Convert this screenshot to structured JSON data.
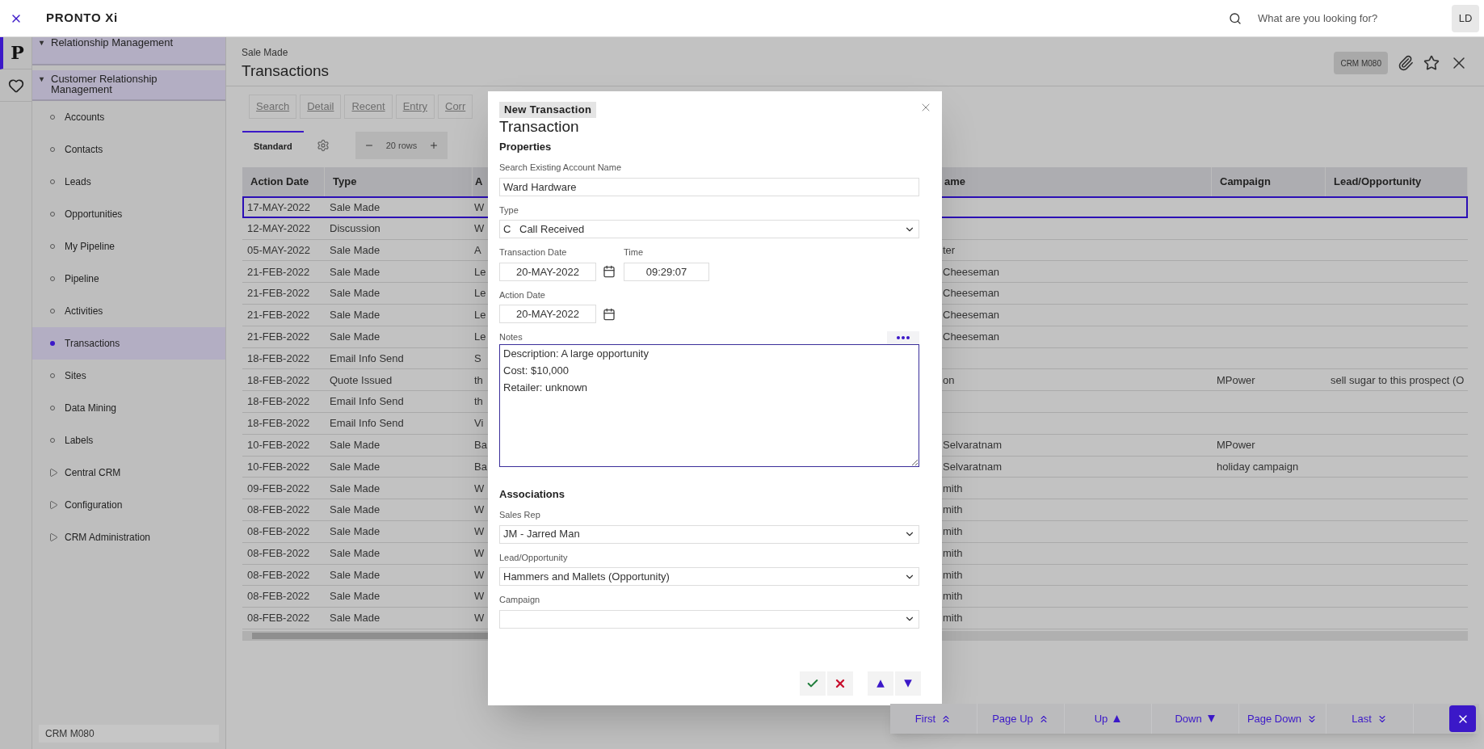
{
  "topbar": {
    "logo": "PRONTO Xi",
    "search_placeholder": "What are you looking for?",
    "avatar": "LD"
  },
  "rail": [
    {
      "kind": "logo",
      "label": "P",
      "selected": true
    },
    {
      "kind": "favorites",
      "selected": false
    }
  ],
  "sidebar": {
    "tree": [
      {
        "label": "Relationship Management",
        "expanded": true,
        "children": [
          {
            "label": "Customer Relationship Management",
            "expanded": true,
            "children": [
              {
                "label": "Accounts",
                "kind": "leaf",
                "selected": false
              },
              {
                "label": "Contacts",
                "kind": "leaf",
                "selected": false
              },
              {
                "label": "Leads",
                "kind": "leaf",
                "selected": false
              },
              {
                "label": "Opportunities",
                "kind": "leaf",
                "selected": false
              },
              {
                "label": "My Pipeline",
                "kind": "leaf",
                "selected": false
              },
              {
                "label": "Pipeline",
                "kind": "leaf",
                "selected": false
              },
              {
                "label": "Activities",
                "kind": "leaf",
                "selected": false
              },
              {
                "label": "Transactions",
                "kind": "leaf",
                "selected": true
              },
              {
                "label": "Sites",
                "kind": "leaf",
                "selected": false
              },
              {
                "label": "Data Mining",
                "kind": "leaf",
                "selected": false
              },
              {
                "label": "Labels",
                "kind": "leaf",
                "selected": false
              },
              {
                "label": "Central CRM",
                "kind": "folder",
                "expanded": false
              },
              {
                "label": "Configuration",
                "kind": "folder",
                "expanded": false
              },
              {
                "label": "CRM Administration",
                "kind": "folder",
                "expanded": false
              }
            ]
          }
        ]
      }
    ],
    "footer": "CRM M080"
  },
  "page": {
    "subtitle": "Sale Made",
    "title": "Transactions",
    "code": "CRM M080"
  },
  "toolbar": [
    "Search",
    "Detail",
    "Recent",
    "Entry",
    "Corr"
  ],
  "view_tabs": [
    {
      "label": "Standard",
      "selected": true
    }
  ],
  "rows_label": "20 rows",
  "table": {
    "columns": [
      "Action Date",
      "Type",
      "A",
      "ame",
      "Campaign",
      "Lead/Opportunity"
    ],
    "rows": [
      {
        "cells": [
          "17-MAY-2022",
          "Sale Made",
          "W",
          "",
          "",
          ""
        ],
        "selected": true
      },
      {
        "cells": [
          "12-MAY-2022",
          "Discussion",
          "W",
          "",
          "",
          ""
        ],
        "selected": false
      },
      {
        "cells": [
          "05-MAY-2022",
          "Sale Made",
          "A",
          "ter",
          "",
          ""
        ],
        "selected": false
      },
      {
        "cells": [
          "21-FEB-2022",
          "Sale Made",
          "Le",
          "Cheeseman",
          "",
          ""
        ],
        "selected": false
      },
      {
        "cells": [
          "21-FEB-2022",
          "Sale Made",
          "Le",
          "Cheeseman",
          "",
          ""
        ],
        "selected": false
      },
      {
        "cells": [
          "21-FEB-2022",
          "Sale Made",
          "Le",
          "Cheeseman",
          "",
          ""
        ],
        "selected": false
      },
      {
        "cells": [
          "21-FEB-2022",
          "Sale Made",
          "Le",
          "Cheeseman",
          "",
          ""
        ],
        "selected": false
      },
      {
        "cells": [
          "18-FEB-2022",
          "Email Info Send",
          "S",
          "",
          "",
          ""
        ],
        "selected": false
      },
      {
        "cells": [
          "18-FEB-2022",
          "Quote Issued",
          "th",
          "on",
          "MPower",
          "sell sugar to this prospect (O"
        ],
        "selected": false
      },
      {
        "cells": [
          "18-FEB-2022",
          "Email Info Send",
          "th",
          "",
          "",
          ""
        ],
        "selected": false
      },
      {
        "cells": [
          "18-FEB-2022",
          "Email Info Send",
          "Vi",
          "",
          "",
          ""
        ],
        "selected": false
      },
      {
        "cells": [
          "10-FEB-2022",
          "Sale Made",
          "Ba",
          "Selvaratnam",
          "MPower",
          ""
        ],
        "selected": false
      },
      {
        "cells": [
          "10-FEB-2022",
          "Sale Made",
          "Ba",
          "Selvaratnam",
          "holiday campaign",
          ""
        ],
        "selected": false
      },
      {
        "cells": [
          "09-FEB-2022",
          "Sale Made",
          "W",
          "mith",
          "",
          ""
        ],
        "selected": false
      },
      {
        "cells": [
          "08-FEB-2022",
          "Sale Made",
          "W",
          "mith",
          "",
          ""
        ],
        "selected": false
      },
      {
        "cells": [
          "08-FEB-2022",
          "Sale Made",
          "W",
          "mith",
          "",
          ""
        ],
        "selected": false
      },
      {
        "cells": [
          "08-FEB-2022",
          "Sale Made",
          "W",
          "mith",
          "",
          ""
        ],
        "selected": false
      },
      {
        "cells": [
          "08-FEB-2022",
          "Sale Made",
          "W",
          "mith",
          "",
          ""
        ],
        "selected": false
      },
      {
        "cells": [
          "08-FEB-2022",
          "Sale Made",
          "W",
          "mith",
          "",
          ""
        ],
        "selected": false
      },
      {
        "cells": [
          "08-FEB-2022",
          "Sale Made",
          "W",
          "mith",
          "",
          ""
        ],
        "selected": false
      }
    ]
  },
  "modal": {
    "badge": "New Transaction",
    "title": "Transaction",
    "properties": {
      "heading": "Properties",
      "account": {
        "label": "Search Existing Account Name",
        "value": "Ward Hardware"
      },
      "type": {
        "label": "Type",
        "code": "C",
        "value": "Call Received"
      },
      "transaction_date": {
        "label": "Transaction Date",
        "value": "20-MAY-2022"
      },
      "time": {
        "label": "Time",
        "value": "09:29:07"
      },
      "action_date": {
        "label": "Action Date",
        "value": "20-MAY-2022"
      },
      "notes": {
        "label": "Notes",
        "lines": [
          "Description: A large opportunity",
          "Cost: $10,000",
          "Retailer: unknown"
        ]
      }
    },
    "associations": {
      "heading": "Associations",
      "sales_rep": {
        "label": "Sales Rep",
        "value": "JM - Jarred Man"
      },
      "lead": {
        "label": "Lead/Opportunity",
        "value": "Hammers and Mallets (Opportunity)"
      },
      "campaign": {
        "label": "Campaign"
      }
    },
    "actions": [
      {
        "kind": "confirm"
      },
      {
        "kind": "cancel"
      },
      {
        "kind": "up"
      },
      {
        "kind": "down"
      }
    ]
  },
  "pager": [
    {
      "label": "First",
      "kind": "first"
    },
    {
      "label": "Page Up",
      "kind": "page_up"
    },
    {
      "label": "Up",
      "kind": "up"
    },
    {
      "label": "Down",
      "kind": "down"
    },
    {
      "label": "Page Down",
      "kind": "page_down"
    },
    {
      "label": "Last",
      "kind": "last"
    }
  ]
}
